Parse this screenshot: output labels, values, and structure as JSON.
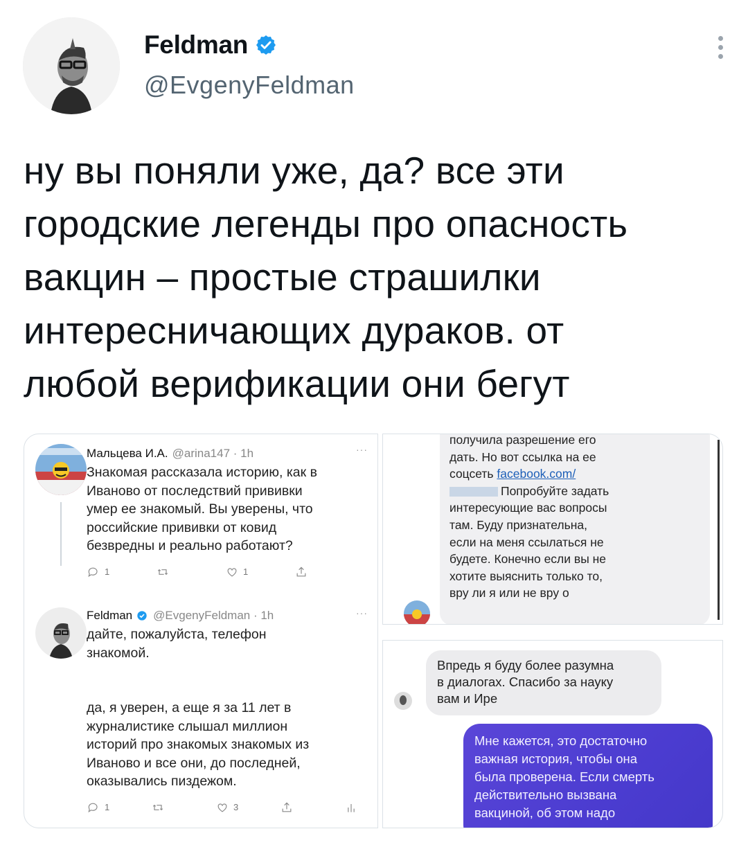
{
  "author": {
    "display_name": "Feldman",
    "handle": "@EvgenyFeldman",
    "verified": true
  },
  "tweet": {
    "lines": [
      "ну вы поняли уже, да? все эти",
      "городские легенды про опасность",
      "вакцин – простые страшилки",
      "интересничающих дураков. от",
      "любой верификации они бегут"
    ]
  },
  "media": {
    "reply_thread": {
      "first": {
        "name": "Мальцева И.А.",
        "meta": "@arina147 · 1h",
        "dots": "···",
        "lines": [
          "Знакомая рассказала историю, как в",
          "Иваново от последствий прививки",
          "умер ее знакомый. Вы уверены, что",
          "российские прививки от ковид",
          "безвредны и реально работают?"
        ],
        "reply_count": "1",
        "retweet_count": "",
        "like_count": "1"
      },
      "second": {
        "name": "Feldman",
        "meta": "@EvgenyFeldman · 1h",
        "dots": "···",
        "lines": [
          "дайте, пожалуйста, телефон",
          "знакомой.",
          "",
          "да, я уверен, а еще я за 11 лет в",
          "журналистике слышал миллион",
          "историй про знакомых знакомых из",
          "Иваново и все они, до последней,",
          "оказывались пиздежом."
        ],
        "reply_count": "1",
        "retweet_count": "",
        "like_count": "3"
      }
    },
    "chat_top": {
      "lines": [
        "получила разрешение его",
        "дать. Но вот ссылка на ее",
        "соцсеть ",
        "Попробуйте задать",
        "интересующие вас вопросы",
        "там. Буду признательна,",
        "если на меня ссылаться не",
        "будете. Конечно если вы не",
        "хотите выяснить только то,",
        "вру ли я или не вру о"
      ],
      "link_text": "facebook.com/"
    },
    "chat_bottom": {
      "incoming_lines": [
        "Впредь я буду более разумна",
        "в диалогах. Спасибо за науку",
        "вам и Ире"
      ],
      "outgoing_lines": [
        "Мне кажется, это достаточно",
        "важная история, чтобы она",
        "была проверена. Если смерть",
        "действительно вызвана",
        "вакциной, об этом надо"
      ]
    }
  },
  "colors": {
    "verified_blue": "#1d9bf0",
    "handle_gray": "#536471",
    "outgoing_bubble": "#4b3cd0"
  },
  "icons": [
    "verified-badge-icon",
    "more-options-icon",
    "reply-icon",
    "retweet-icon",
    "like-icon",
    "share-icon",
    "stats-icon"
  ]
}
